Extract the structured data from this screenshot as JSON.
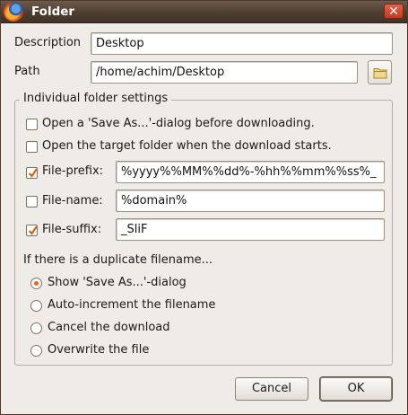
{
  "window": {
    "title": "Folder",
    "close_icon": "close-icon"
  },
  "description": {
    "label": "Description",
    "value": "Desktop"
  },
  "path": {
    "label": "Path",
    "value": "/home/achim/Desktop",
    "browse_icon": "folder-icon"
  },
  "group": {
    "title": "Individual folder settings",
    "options": [
      {
        "label": "Open a 'Save As...'-dialog before downloading.",
        "checked": false
      },
      {
        "label": "Open the target folder when the download starts.",
        "checked": false
      }
    ],
    "prefix": {
      "label": "File-prefix:",
      "checked": true,
      "value": "%yyyy%%MM%%dd%-%hh%%mm%%ss%_"
    },
    "name": {
      "label": "File-name:",
      "checked": false,
      "value": "%domain%"
    },
    "suffix": {
      "label": "File-suffix:",
      "checked": true,
      "value": "_SliF"
    },
    "duplicate_heading": "If there is a duplicate filename...",
    "duplicate_options": [
      {
        "label": "Show 'Save As...'-dialog",
        "selected": true
      },
      {
        "label": "Auto-increment the filename",
        "selected": false
      },
      {
        "label": "Cancel the download",
        "selected": false
      },
      {
        "label": "Overwrite the file",
        "selected": false
      }
    ]
  },
  "buttons": {
    "cancel": "Cancel",
    "ok": "OK"
  },
  "colors": {
    "titlebar": "#4f3f33",
    "accent": "#e4661f",
    "background": "#efebe7"
  }
}
